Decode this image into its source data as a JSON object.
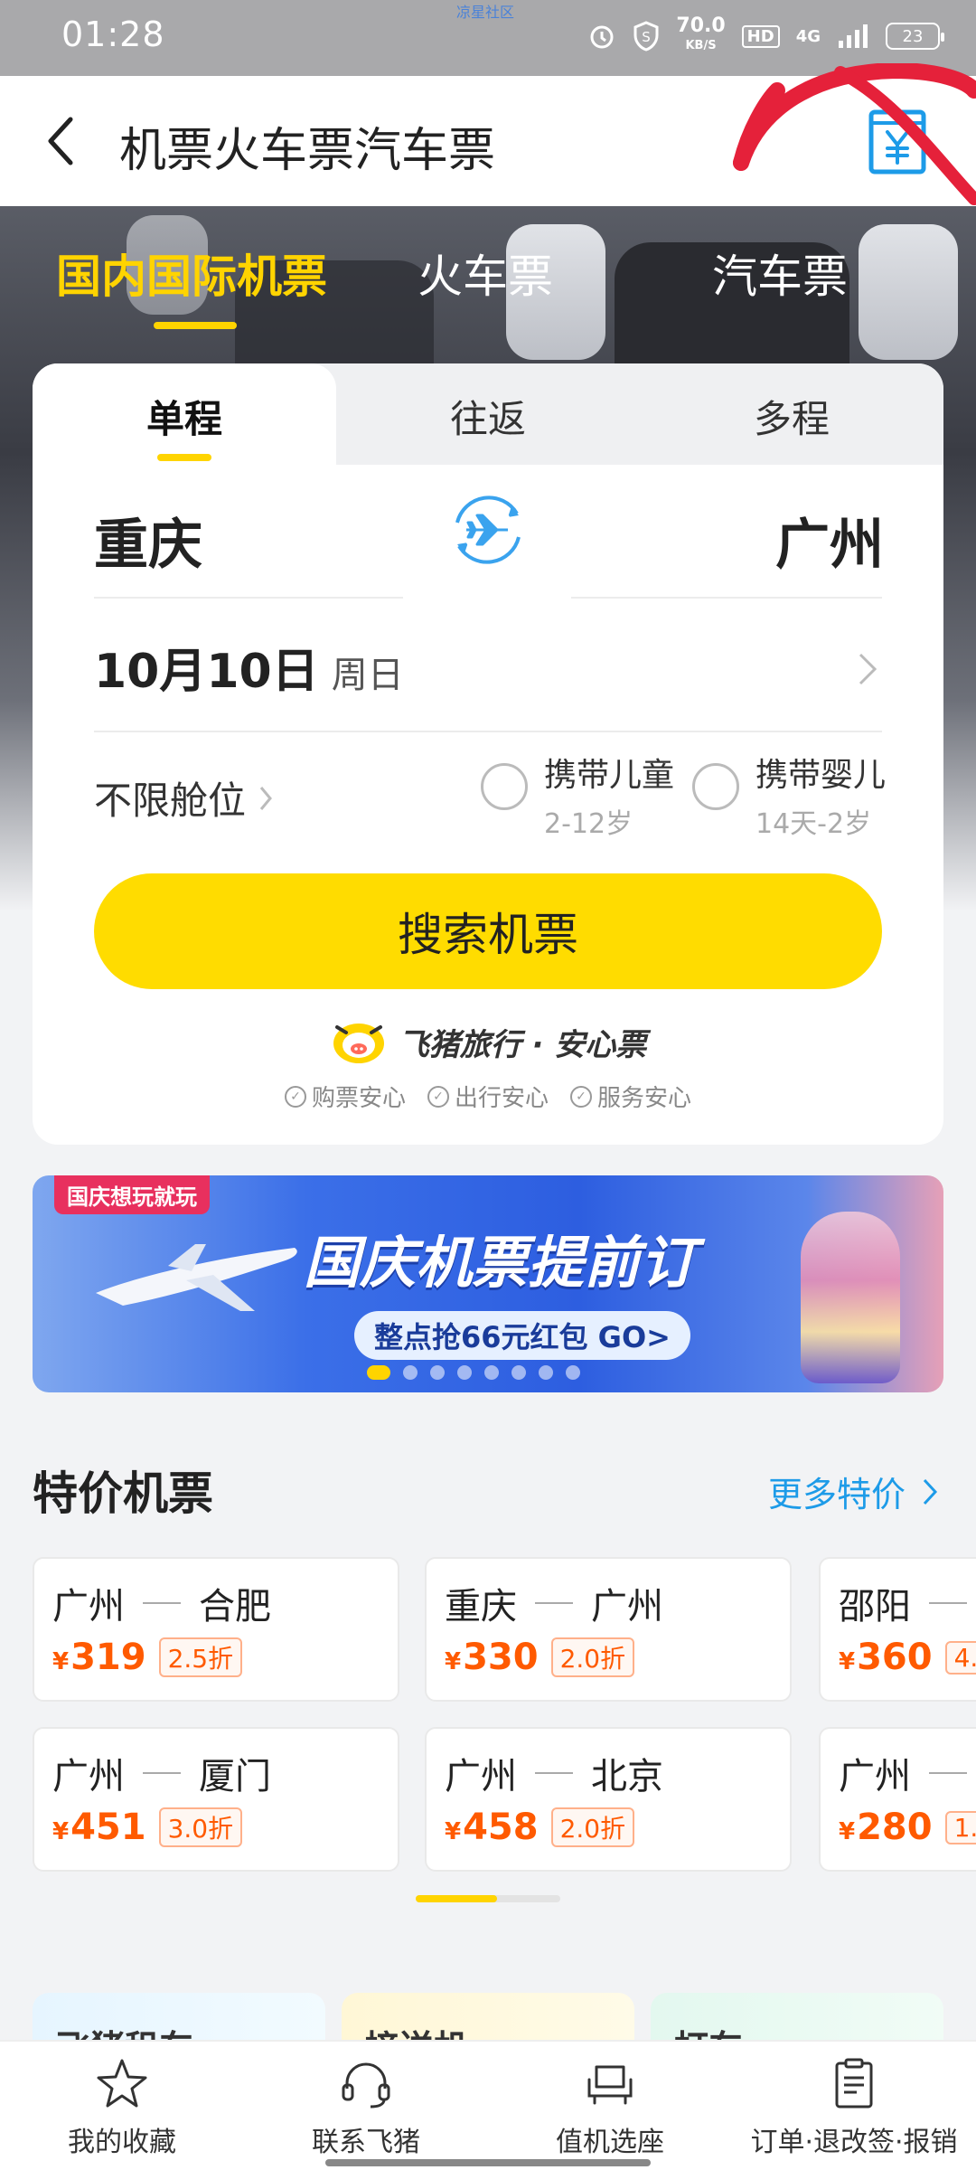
{
  "status_bar": {
    "time": "01:28",
    "watermark": "凉星社区",
    "speed_value": "70.0",
    "speed_unit": "KB/S",
    "hd": "HD",
    "network": "4G",
    "battery": "23"
  },
  "header": {
    "title": "机票火车票汽车票"
  },
  "top_tabs": [
    {
      "label": "国内国际机票",
      "active": true
    },
    {
      "label": "火车票",
      "active": false
    },
    {
      "label": "汽车票",
      "active": false
    }
  ],
  "trip_tabs": [
    {
      "label": "单程",
      "active": true
    },
    {
      "label": "往返",
      "active": false
    },
    {
      "label": "多程",
      "active": false
    }
  ],
  "search": {
    "from_city": "重庆",
    "to_city": "广州",
    "date": "10月10日",
    "weekday": "周日",
    "cabin": "不限舱位",
    "child_label": "携带儿童",
    "child_sub": "2-12岁",
    "infant_label": "携带婴儿",
    "infant_sub": "14天-2岁",
    "button": "搜索机票"
  },
  "brand": {
    "name": "飞猪旅行 · 安心票",
    "guarantees": [
      "购票安心",
      "出行安心",
      "服务安心"
    ]
  },
  "banner": {
    "tag": "国庆想玩就玩",
    "title": "国庆机票提前订",
    "subtitle": "整点抢66元红包 GO>",
    "dot_count": 8,
    "active_dot": 0
  },
  "deals": {
    "title": "特价机票",
    "more": "更多特价",
    "currency": "¥",
    "items": [
      {
        "from": "广州",
        "to": "合肥",
        "price": "319",
        "discount": "2.5折"
      },
      {
        "from": "重庆",
        "to": "广州",
        "price": "330",
        "discount": "2.0折"
      },
      {
        "from": "邵阳",
        "to": "…",
        "price": "360",
        "discount": "4."
      },
      {
        "from": "广州",
        "to": "厦门",
        "price": "451",
        "discount": "3.0折"
      },
      {
        "from": "广州",
        "to": "北京",
        "price": "458",
        "discount": "2.0折"
      },
      {
        "from": "广州",
        "to": "…",
        "price": "280",
        "discount": "1."
      }
    ]
  },
  "promos": [
    "飞猪租车",
    "接送机",
    "打车"
  ],
  "bottom_nav": [
    {
      "label": "我的收藏",
      "icon": "star-icon"
    },
    {
      "label": "联系飞猪",
      "icon": "headset-icon"
    },
    {
      "label": "值机选座",
      "icon": "seat-icon"
    },
    {
      "label": "订单·退改签·报销",
      "icon": "clipboard-icon"
    }
  ],
  "colors": {
    "accent_yellow": "#ffdc00",
    "price_orange": "#ff5a00",
    "link_blue": "#1d9be8",
    "annotation_red": "#e5213a"
  }
}
